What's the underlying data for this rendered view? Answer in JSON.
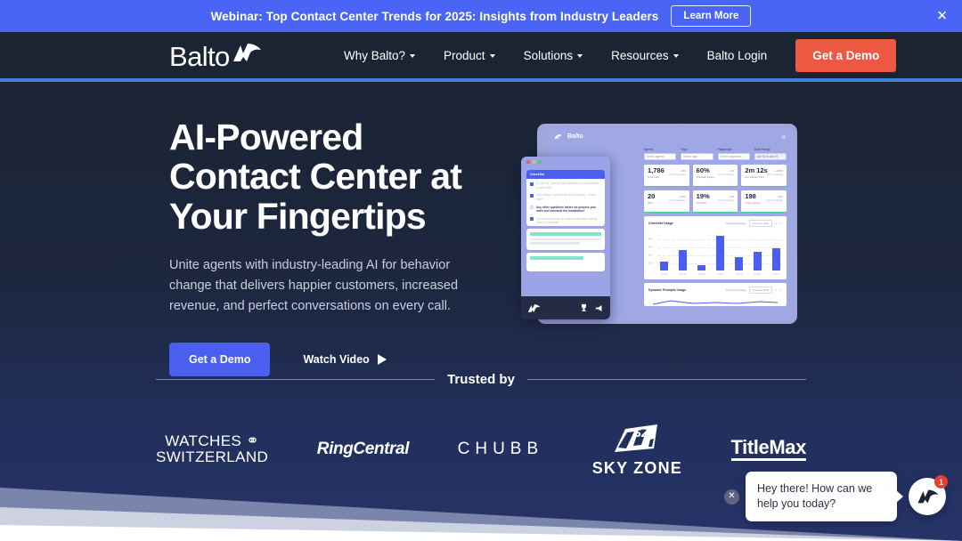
{
  "banner": {
    "text": "Webinar: Top Contact Center Trends for 2025: Insights from Industry Leaders",
    "cta_label": "Learn More",
    "close_icon": "close-icon",
    "background": "#4a64f5"
  },
  "nav": {
    "logo_text": "Balto",
    "logo_mark": "balto-bird-icon",
    "items": [
      {
        "label": "Why Balto?",
        "has_dropdown": true
      },
      {
        "label": "Product",
        "has_dropdown": true
      },
      {
        "label": "Solutions",
        "has_dropdown": true
      },
      {
        "label": "Resources",
        "has_dropdown": true
      }
    ],
    "login_label": "Balto Login",
    "cta_label": "Get a Demo",
    "cta_color": "#ee5842",
    "accent_color": "#3b82d8",
    "background": "#1b2433"
  },
  "hero": {
    "title": "AI-Powered Contact Center at Your Fingertips",
    "subtitle": "Unite agents with industry-leading AI for behavior change that delivers happier customers, increased revenue, and perfect conversations on every call.",
    "primary_cta": "Get a Demo",
    "secondary_cta": "Watch Video",
    "play_icon": "play-icon",
    "primary_cta_color": "#4a5ef0"
  },
  "mockup": {
    "window_title": "Balto",
    "filters": [
      {
        "label": "Agents",
        "value": "Select agents"
      },
      {
        "label": "Tags",
        "value": "Select tags"
      },
      {
        "label": "Playbooks",
        "value": "Select playbooks"
      },
      {
        "label": "Date Range",
        "value": "Jun 01 to Jun 07"
      }
    ],
    "stats": [
      {
        "value": "1,786",
        "label": "Total Calls",
        "delta": "+3%",
        "since": "From Yesterday"
      },
      {
        "value": "60%",
        "label": "Checklist Usage",
        "delta": "+7%",
        "since": "From Yesterday"
      },
      {
        "value": "2m 12s",
        "label": "Avg Handle Time",
        "delta": "+106%",
        "since": "From Yesterday"
      },
      {
        "value": "20",
        "label": "Wins",
        "delta": "+10%",
        "since": "From Yesterday"
      },
      {
        "value": "19%",
        "label": "Win Rate",
        "delta": "+2%",
        "since": "From Yesterday"
      },
      {
        "value": "198",
        "label": "Active Agents",
        "delta": "+4%",
        "since": "From Yesterday"
      }
    ],
    "chart_panel": {
      "title": "Checklist Usage",
      "control_label": "Show Percentage",
      "select_value": "Group by Date"
    },
    "second_panel": {
      "title": "Dynamic Prompts Usage",
      "control_label": "Show Percentage",
      "select_value": "Group by Date"
    },
    "chat_panel": {
      "card_title": "Checklist",
      "items": [
        {
          "text": "So tell me, what got you interested in our solution to start with?",
          "checked": true,
          "active": false
        },
        {
          "text": "Interesting, it sounds like you're saying... is that right?",
          "checked": true,
          "active": false
        },
        {
          "text": "Any other questions before we process your order and schedule the installation?",
          "checked": false,
          "active": true
        },
        {
          "text": "You should receive an email confirmation shortly. Have a great day!",
          "checked": true,
          "active": false
        }
      ]
    }
  },
  "chart_data": {
    "type": "bar",
    "title": "Checklist Usage",
    "categories": [
      "Jun 01",
      "Jun 02",
      "Jun 03",
      "Jun 04",
      "Jun 05",
      "Jun 06",
      "Jun 07"
    ],
    "values": [
      20,
      46,
      12,
      78,
      30,
      42,
      50
    ],
    "yticks": [
      "10K",
      "20K",
      "30K",
      "40K"
    ],
    "ylim": [
      0,
      90
    ],
    "xlabel": "",
    "ylabel": "",
    "grid": true,
    "bar_color": "#4a5ef0",
    "legend": "none"
  },
  "trusted": {
    "label": "Trusted by",
    "clients": [
      {
        "name": "Watches of Switzerland",
        "line1": "WATCHES",
        "line2": "SWITZERLAND",
        "mark": "of-mark"
      },
      {
        "name": "RingCentral",
        "text": "RingCentral"
      },
      {
        "name": "Chubb",
        "text": "CHUBB"
      },
      {
        "name": "Sky Zone",
        "text": "SKY ZONE",
        "mark": "sz-flag-icon"
      },
      {
        "name": "TitleMax",
        "text": "TitleMax"
      }
    ]
  },
  "chat_widget": {
    "message": "Hey there! How can we help you today?",
    "badge_count": "1",
    "close_icon": "close-icon",
    "avatar_icon": "balto-bird-icon",
    "badge_color": "#ee3a2f"
  },
  "decor": {
    "band1_color": "#7b85ab",
    "band2_color": "#cdd2e2",
    "band3_color": "#ffffff"
  }
}
